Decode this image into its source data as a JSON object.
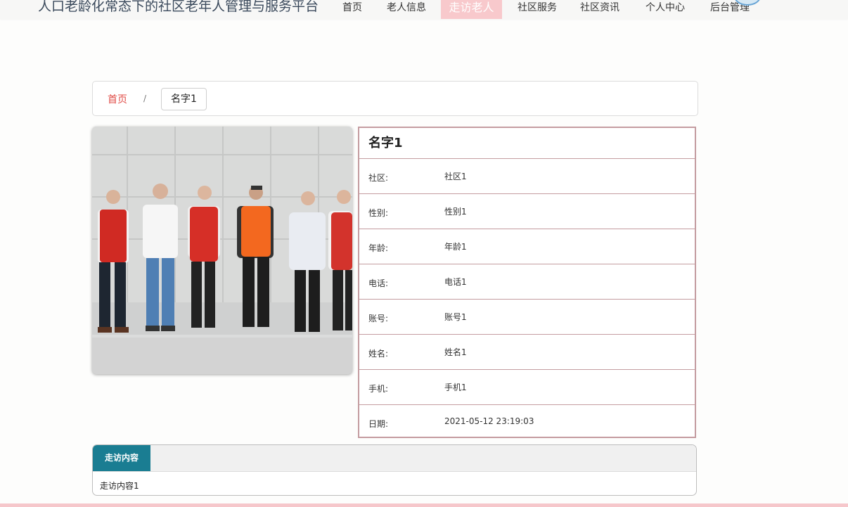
{
  "site": {
    "title": "人口老龄化常态下的社区老年人管理与服务平台"
  },
  "nav": {
    "items": [
      "首页",
      "老人信息",
      "走访老人",
      "社区服务",
      "社区资讯",
      "个人中心",
      "后台管理"
    ],
    "active_item": "走访老人",
    "active_color": "#f8c9cc"
  },
  "breadcrumb": {
    "home": "首页",
    "separator": "/",
    "current": "名字1"
  },
  "photo": {
    "description_icon": "group-photo",
    "alt": ""
  },
  "detail": {
    "name": "名字1",
    "fields": [
      {
        "label": "社区:",
        "value": "社区1"
      },
      {
        "label": "性别:",
        "value": "性别1"
      },
      {
        "label": "年龄:",
        "value": "年龄1"
      },
      {
        "label": "电话:",
        "value": "电话1"
      },
      {
        "label": "账号:",
        "value": "账号1"
      },
      {
        "label": "姓名:",
        "value": "姓名1"
      },
      {
        "label": "手机:",
        "value": "手机1"
      },
      {
        "label": "日期:",
        "value": "2021-05-12 23:19:03"
      }
    ],
    "border_color": "#c49ca0"
  },
  "visit": {
    "tab_label": "走访内容",
    "content": "走访内容1",
    "tab_color": "#1a7d92"
  }
}
